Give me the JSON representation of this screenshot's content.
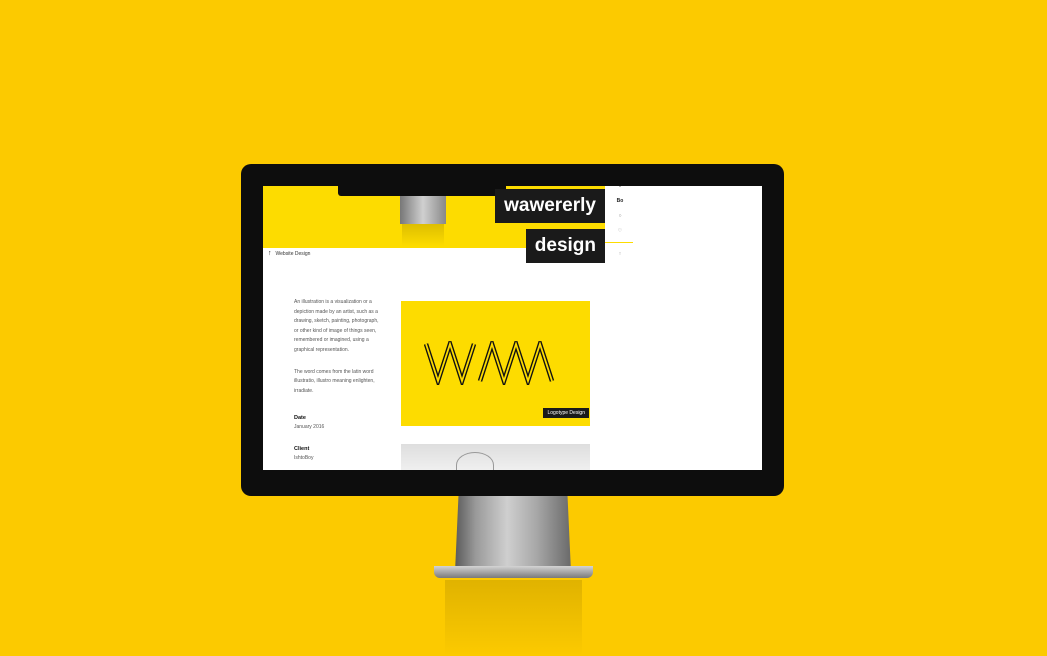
{
  "colors": {
    "background": "#FCCA00",
    "accent": "#FDDC00",
    "monitor": "#0d0d0d",
    "chip": "#1a1a1a"
  },
  "hero": {
    "title_line1": "wawererly",
    "title_line2": "design"
  },
  "side_rail": {
    "icons": [
      "dot-icon",
      "bookmark-icon",
      "plus-icon",
      "heart-icon",
      "up-arrow-icon"
    ],
    "label": "Bo"
  },
  "back_nav": {
    "label": "Website Design"
  },
  "description": {
    "paragraph1": "An illustration is a visualization or a depiction made by an artist, such as a drawing, sketch, painting, photograph, or other kind of image of things seen, remembered or imagined, using a graphical representation.",
    "paragraph2": "The word comes from the latin word illustratio, illustro meaning enlighten, irradiate."
  },
  "meta": {
    "date_label": "Date",
    "date_value": "January 2016",
    "client_label": "Client",
    "client_value": "IshtoBoy"
  },
  "works": [
    {
      "logo_text": "WM",
      "tag": "Logotype Design"
    }
  ]
}
